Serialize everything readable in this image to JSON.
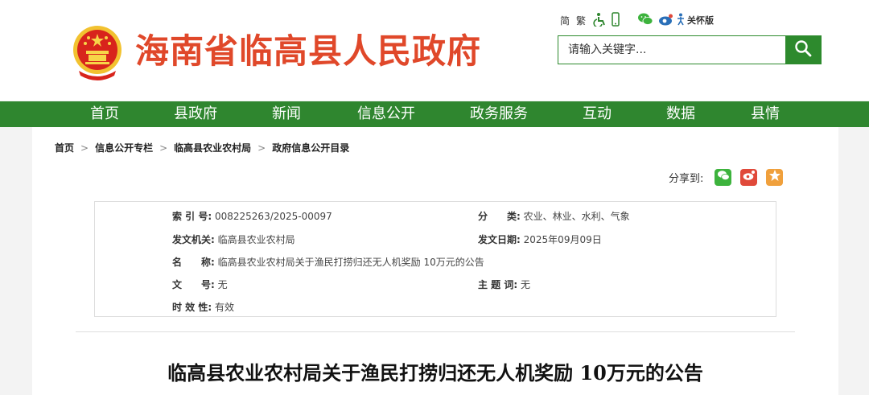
{
  "header": {
    "site_title": "海南省临高县人民政府",
    "top_links": {
      "simplified": "简",
      "traditional": "繁",
      "care_mode": "关怀版"
    },
    "search": {
      "placeholder": "请输入关键字..."
    }
  },
  "nav": [
    "首页",
    "县政府",
    "新闻",
    "信息公开",
    "政务服务",
    "互动",
    "数据",
    "县情"
  ],
  "breadcrumb": [
    "首页",
    "信息公开专栏",
    "临高县农业农村局",
    "政府信息公开目录"
  ],
  "breadcrumb_sep": ">",
  "share": {
    "label": "分享到:"
  },
  "info": {
    "index_no_label": "索 引 号:",
    "index_no": "008225263/2025-00097",
    "category_label": "分　　类:",
    "category": "农业、林业、水利、气象",
    "issuer_label": "发文机关:",
    "issuer": "临高县农业农村局",
    "date_label": "发文日期:",
    "date": "2025年09月09日",
    "name_label": "名　　称:",
    "name": "临高县农业农村局关于渔民打捞归还无人机奖励 10万元的公告",
    "doc_no_label": "文　　号:",
    "doc_no": "无",
    "subject_label": "主 题 词:",
    "subject": "无",
    "validity_label": "时 效 性:",
    "validity": "有效"
  },
  "article": {
    "title": "临高县农业农村局关于渔民打捞归还无人机奖励 10万元的公告"
  },
  "colors": {
    "nav_green": "#2f862f",
    "title_red": "#e0482a",
    "wechat": "#3db33d",
    "weibo": "#e0493a",
    "favorite": "#f0a03c"
  },
  "icons": [
    "national-emblem-icon",
    "accessibility-icon",
    "mobile-icon",
    "wechat-icon",
    "weibo-icon",
    "care-mode-icon",
    "search-icon",
    "favorite-icon"
  ]
}
